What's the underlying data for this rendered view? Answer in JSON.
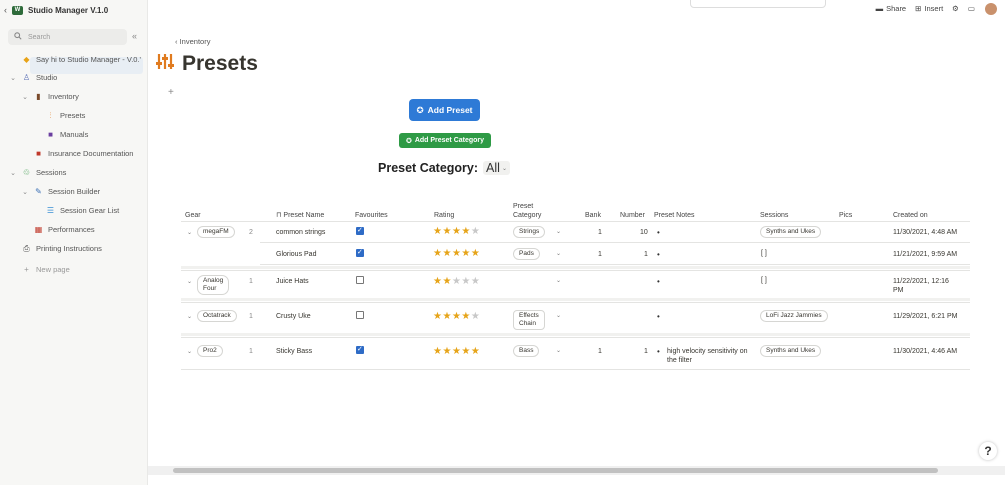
{
  "sidebar": {
    "workspace_name": "Studio Manager V.1.0",
    "search_placeholder": "Search",
    "items": [
      {
        "label": "Say hi to Studio Manager - V.0.'",
        "toggle": ""
      },
      {
        "label": "Studio",
        "toggle": "⌄"
      },
      {
        "label": "Inventory",
        "toggle": "⌄"
      },
      {
        "label": "Presets",
        "toggle": ""
      },
      {
        "label": "Manuals",
        "toggle": ""
      },
      {
        "label": "Insurance Documentation",
        "toggle": ""
      },
      {
        "label": "Sessions",
        "toggle": "⌄"
      },
      {
        "label": "Session Builder",
        "toggle": "⌄"
      },
      {
        "label": "Session Gear List",
        "toggle": ""
      },
      {
        "label": "Performances",
        "toggle": ""
      },
      {
        "label": "Printing Instructions",
        "toggle": ""
      },
      {
        "label": "New page",
        "toggle": "+"
      }
    ]
  },
  "topbar": {
    "share": "Share",
    "insert": "Insert"
  },
  "breadcrumb": "Inventory",
  "page_title": "Presets",
  "buttons": {
    "add_preset": "Add Preset",
    "add_category": "Add Preset Category"
  },
  "filter": {
    "label": "Preset Category:",
    "value": "All"
  },
  "table": {
    "headers": {
      "gear": "Gear",
      "preset_name": "Preset Name",
      "favourites": "Favourites",
      "rating": "Rating",
      "preset_category_1": "Preset",
      "preset_category_2": "Category",
      "bank": "Bank",
      "number": "Number",
      "preset_notes": "Preset Notes",
      "sessions": "Sessions",
      "pics": "Pics",
      "created_on": "Created on"
    },
    "groups": [
      {
        "gear": "megaFM",
        "count": "2",
        "rows": [
          {
            "name": "common strings",
            "fav": true,
            "rating": 4,
            "category": "Strings",
            "bank": "1",
            "number": "10",
            "notes": "",
            "sessions": "Synths and Ukes",
            "created": "11/30/2021, 4:48 AM",
            "created2": ""
          },
          {
            "name": "Glorious Pad",
            "fav": true,
            "rating": 5,
            "category": "Pads",
            "bank": "1",
            "number": "1",
            "notes": "",
            "sessions": "[ ]",
            "created": "11/21/2021, 9:59 AM",
            "created2": ""
          }
        ]
      },
      {
        "gear": "Analog Four",
        "gear_line1": "Analog",
        "gear_line2": "Four",
        "count": "1",
        "rows": [
          {
            "name": "Juice Hats",
            "fav": false,
            "rating": 2,
            "category": "",
            "bank": "",
            "number": "",
            "notes": "",
            "sessions": "[ ]",
            "created": "11/22/2021, 12:16",
            "created2": "PM"
          }
        ]
      },
      {
        "gear": "Octatrack",
        "count": "1",
        "rows": [
          {
            "name": "Crusty Uke",
            "fav": false,
            "rating": 4,
            "category": "Effects Chain",
            "category_line1": "Effects",
            "category_line2": "Chain",
            "bank": "",
            "number": "",
            "notes": "",
            "sessions": "LoFi Jazz Jammies",
            "created": "11/29/2021, 6:21 PM",
            "created2": ""
          }
        ]
      },
      {
        "gear": "Pro2",
        "count": "1",
        "rows": [
          {
            "name": "Sticky Bass",
            "fav": true,
            "rating": 5,
            "category": "Bass",
            "bank": "1",
            "number": "1",
            "notes": "high velocity sensitivity on the filter",
            "notes_line1": "high velocity sensitivity on",
            "notes_line2": "the filter",
            "sessions": "Synths and Ukes",
            "created": "11/30/2021, 4:46 AM",
            "created2": ""
          }
        ]
      }
    ]
  },
  "help_label": "?",
  "colors": {
    "accent_blue": "#2e7ad6",
    "accent_green": "#2e9a45",
    "star": "#e6a419",
    "checkbox": "#2e6bc6"
  }
}
